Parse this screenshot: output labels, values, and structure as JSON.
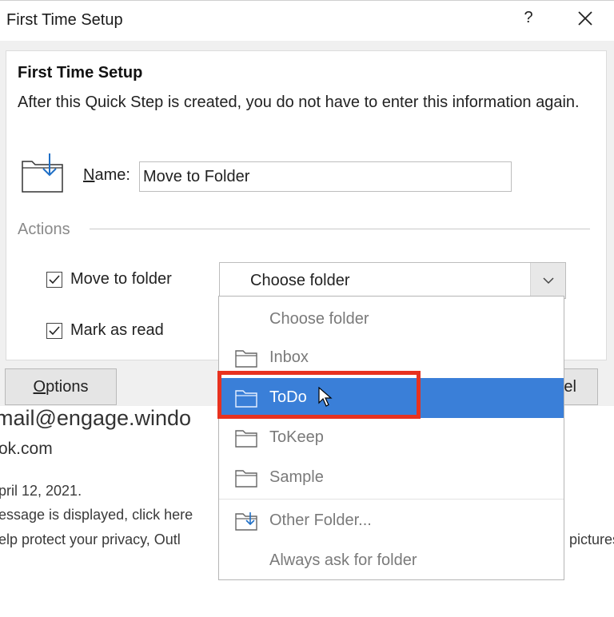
{
  "window": {
    "title": "First Time Setup",
    "help_glyph": "?",
    "close_icon": "close-icon"
  },
  "setup": {
    "heading": "First Time Setup",
    "description": "After this Quick Step is created, you do not have to enter this information again.",
    "quickstep_icon": "move-to-folder-icon",
    "name_label_accel": "N",
    "name_label_rest": "ame:",
    "name_value": "Move to Folder",
    "actions_label": "Actions",
    "actions": [
      {
        "label": "Move to folder",
        "checked": true
      },
      {
        "label": "Mark as read",
        "checked": true
      }
    ],
    "folder_combo_value": "Choose folder"
  },
  "dropdown": {
    "items": [
      {
        "label": "Choose folder",
        "icon": ""
      },
      {
        "label": "Inbox",
        "icon": "folder-icon"
      },
      {
        "label": "ToDo",
        "icon": "folder-icon",
        "selected": true
      },
      {
        "label": "ToKeep",
        "icon": "folder-icon"
      },
      {
        "label": "Sample",
        "icon": "folder-icon"
      },
      {
        "label": "Other Folder...",
        "icon": "folder-arrow-icon"
      },
      {
        "label": "Always ask for folder",
        "icon": ""
      }
    ]
  },
  "buttons": {
    "options_accel": "O",
    "options_rest": "ptions",
    "cancel_partial": "el"
  },
  "background_mail": {
    "from_partial": "mail@engage.windo",
    "domain_partial": "ok.com",
    "date_partial": "pril 12, 2021.",
    "message_partial": "essage is displayed, click here",
    "privacy_partial": "elp protect your privacy, Outl",
    "pictures_partial": "pictures"
  },
  "colors": {
    "selection": "#3a7fd8",
    "highlight_box": "#e8321f",
    "dialog_bg": "#f0f0f0"
  }
}
